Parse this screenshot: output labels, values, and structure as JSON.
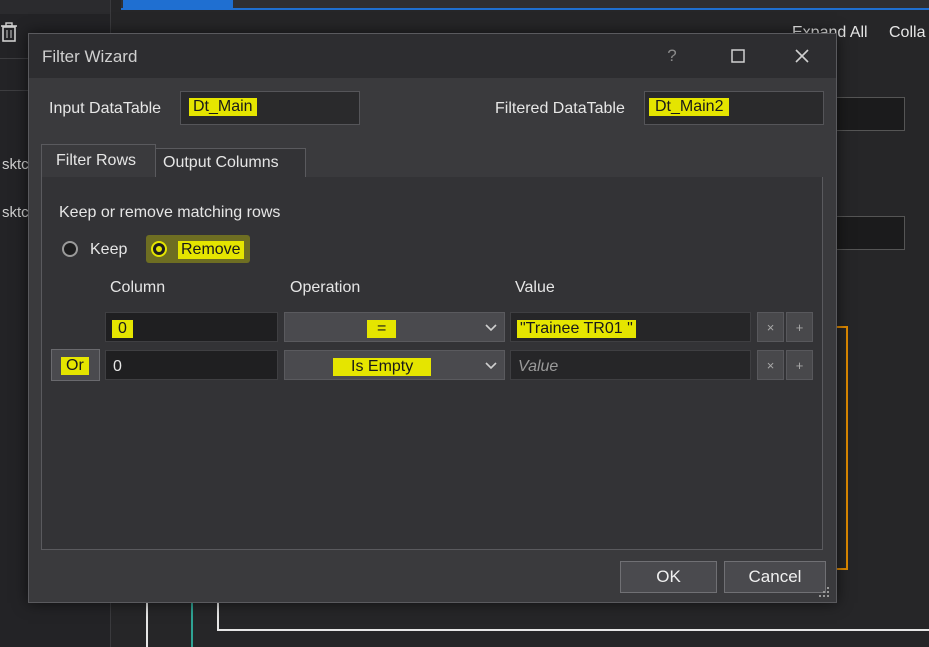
{
  "background": {
    "expand_all": "Expand All",
    "collapse_truncated": "Colla",
    "truncated_item_1": "sktc",
    "truncated_item_2": "sktc",
    "trash_icon": "trash-icon"
  },
  "dialog": {
    "title": "Filter Wizard",
    "help": "?",
    "maximize_icon": "maximize-icon",
    "close_icon": "close-icon",
    "input_label": "Input DataTable",
    "input_value": "Dt_Main",
    "filtered_label": "Filtered DataTable",
    "filtered_value": "Dt_Main2",
    "tabs": [
      {
        "label": "Filter Rows",
        "active": true
      },
      {
        "label": "Output Columns",
        "active": false
      }
    ],
    "section_label": "Keep or remove matching rows",
    "radio_keep": "Keep",
    "radio_remove": "Remove",
    "selected_mode": "Remove",
    "columns": {
      "column": "Column",
      "operation": "Operation",
      "value": "Value"
    },
    "rows": [
      {
        "connector": "",
        "column": "0",
        "operation": "=",
        "value": "\"Trainee TR01 \"",
        "value_placeholder": ""
      },
      {
        "connector": "Or",
        "column": "0",
        "operation": "Is Empty",
        "value": "",
        "value_placeholder": "Value"
      }
    ],
    "remove_symbol": "×",
    "add_symbol": "+",
    "ok": "OK",
    "cancel": "Cancel"
  },
  "colors": {
    "highlight": "#e5e500",
    "accent_blue": "#1f6fd1",
    "orange": "#e08a00"
  }
}
